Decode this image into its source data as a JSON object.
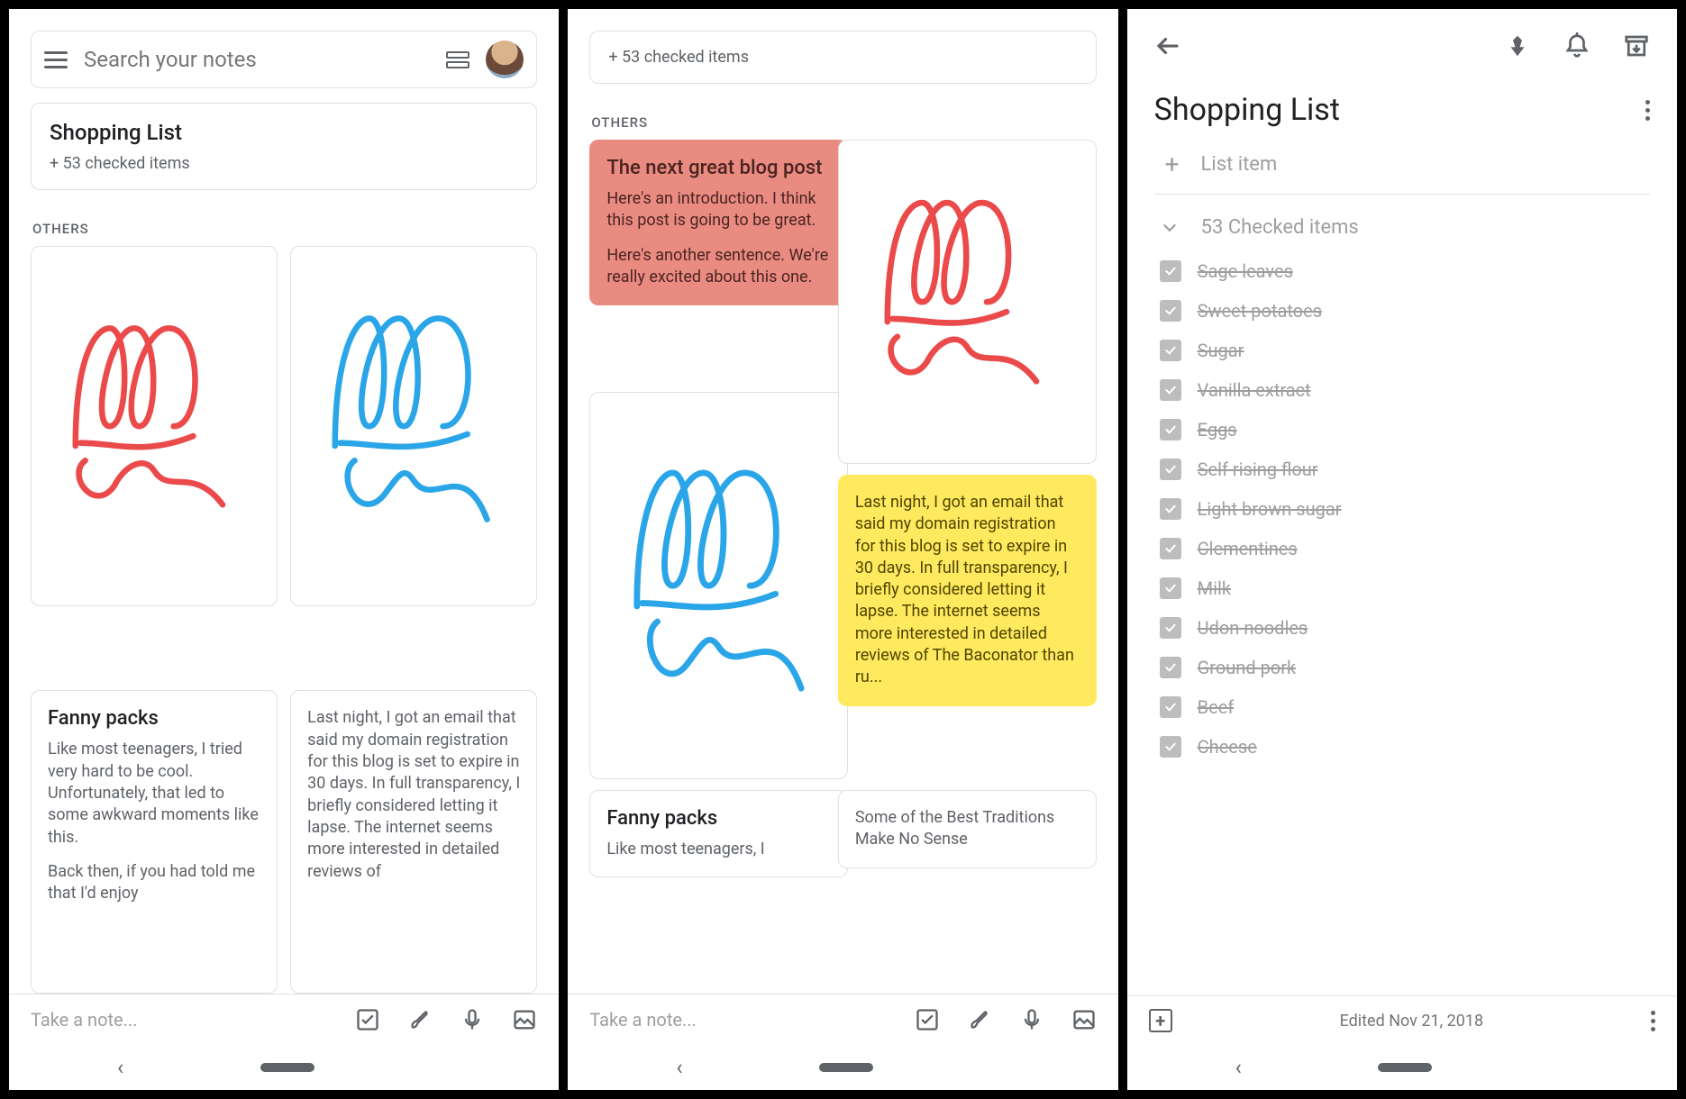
{
  "panel1": {
    "search_placeholder": "Search your notes",
    "pinned": {
      "title": "Shopping List",
      "sub": "+ 53 checked items"
    },
    "section": "OTHERS",
    "notes": {
      "fanny": {
        "title": "Fanny packs",
        "p1": "Like most teenagers, I tried very hard to be cool. Unfortunately, that led to some awkward moments like this.",
        "p2": "Back then, if you had told me that I'd enjoy"
      },
      "domain": {
        "body": "Last night, I got an email that said my domain registration for this blog is set to expire in 30 days. In full transparency, I briefly considered letting it lapse. The internet seems more interested in detailed reviews of"
      }
    },
    "take_note": "Take a note..."
  },
  "panel2": {
    "pinned_sub": "+ 53 checked items",
    "section": "OTHERS",
    "blog": {
      "title": "The next great blog post",
      "p1": "Here's an introduction. I think this post is going to be great.",
      "p2": "Here's another sentence. We're really excited about this one."
    },
    "domain": {
      "body": "Last night, I got an email that said my domain registration for this blog is set to expire in 30 days. In full transparency, I briefly considered letting it lapse. The internet seems more interested in detailed reviews of The Baconator than ru..."
    },
    "fanny": {
      "title": "Fanny packs",
      "body": "Like most teenagers, I"
    },
    "traditions": {
      "body": "Some of the Best Traditions Make No Sense"
    },
    "take_note": "Take a note..."
  },
  "panel3": {
    "title": "Shopping List",
    "add_placeholder": "List item",
    "checked_header": "53 Checked items",
    "items": [
      "Sage leaves",
      "Sweet potatoes",
      "Sugar",
      "Vanilla extract",
      "Eggs",
      "Self rising flour",
      "Light brown sugar",
      "Clementines",
      "Milk",
      "Udon noodles",
      "Ground pork",
      "Beef",
      "Cheese"
    ],
    "edited": "Edited Nov 21, 2018"
  }
}
